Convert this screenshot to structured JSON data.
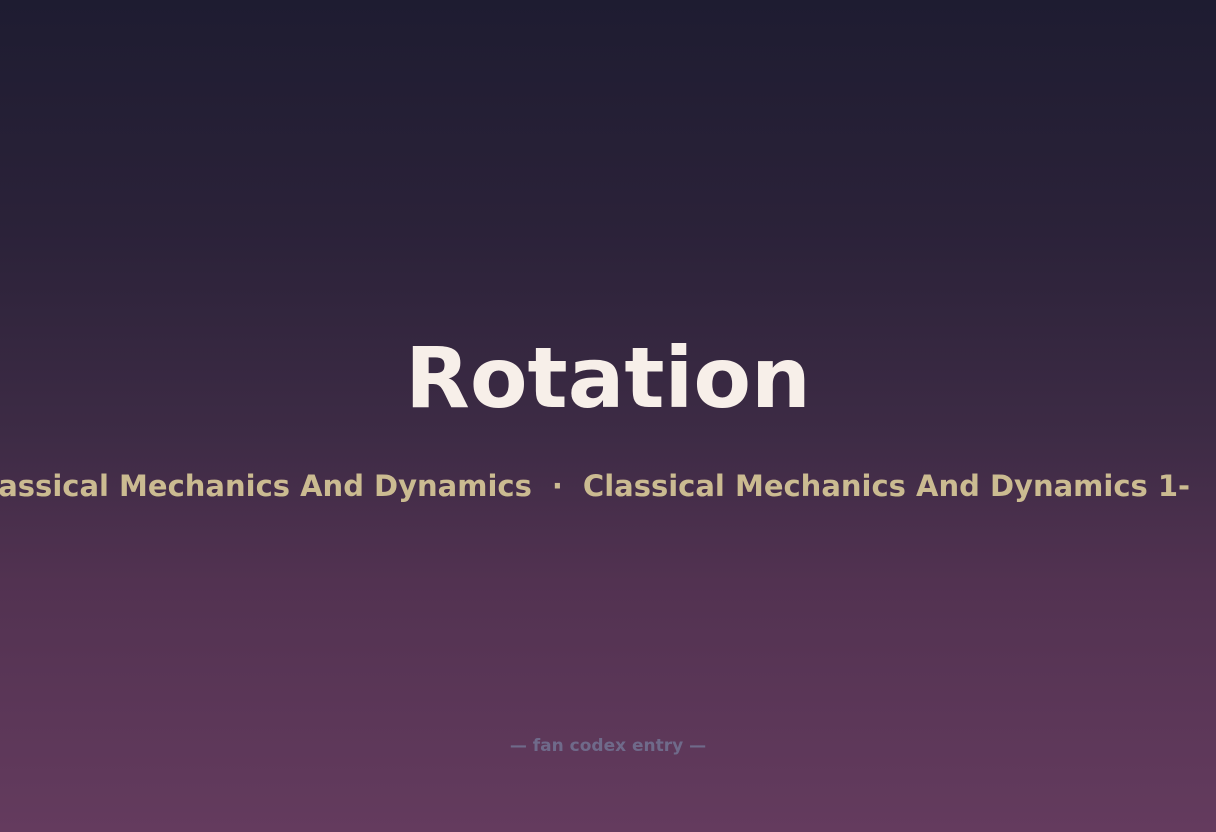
{
  "page": {
    "title": "Rotation",
    "ticker": {
      "items": [
        "Classical Mechanics And Dynamics",
        "Classical Mechanics And Dynamics 1-"
      ],
      "separator": "·"
    },
    "footer_note": "— fan codex entry —"
  },
  "colors": {
    "title": "#f7efe9",
    "ticker": "#cbbb91",
    "footer_note": "#6f6a8a",
    "background_top": "#1e1c31",
    "background_bottom": "#643b5e"
  }
}
